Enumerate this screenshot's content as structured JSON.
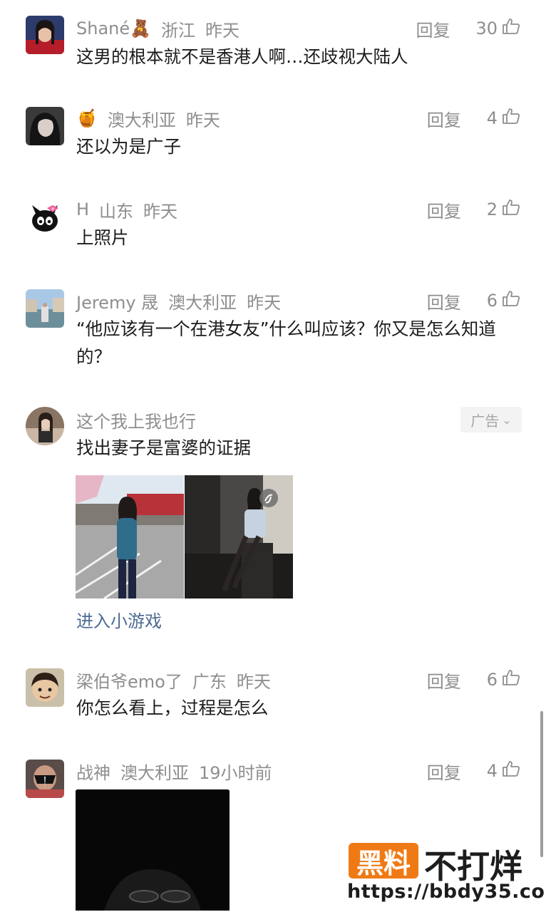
{
  "comments": [
    {
      "username": "Shané🧸",
      "location": "浙江",
      "time": "昨天",
      "reply_label": "回复",
      "likes": "30",
      "text": "这男的根本就不是香港人啊…还歧视大陆人"
    },
    {
      "username": "🍯",
      "location": "澳大利亚",
      "time": "昨天",
      "reply_label": "回复",
      "likes": "4",
      "text": "还以为是广子"
    },
    {
      "username": "H",
      "location": "山东",
      "time": "昨天",
      "reply_label": "回复",
      "likes": "2",
      "text": "上照片"
    },
    {
      "username": "Jeremy 晟",
      "location": "澳大利亚",
      "time": "昨天",
      "reply_label": "回复",
      "likes": "6",
      "text": "“他应该有一个在港女友”什么叫应该？你又是怎么知道的？"
    },
    {
      "username": "梁伯爷emo了",
      "location": "广东",
      "time": "昨天",
      "reply_label": "回复",
      "likes": "6",
      "text": "你怎么看上，过程是怎么"
    },
    {
      "username": "战神",
      "location": "澳大利亚",
      "time": "19小时前",
      "reply_label": "回复",
      "likes": "4"
    }
  ],
  "ad": {
    "username": "这个我上我也行",
    "badge": "广告",
    "badge_chevron": "⌄",
    "text": "找出妻子是富婆的证据",
    "link": "进入小游戏"
  },
  "watermark": {
    "box_text": "黑料",
    "text": "不打烊",
    "url": "https://bbdy35.com"
  },
  "colors": {
    "meta_gray": "#8e8e8e",
    "link_blue": "#4d6a94",
    "watermark_orange": "#ef7a14"
  }
}
